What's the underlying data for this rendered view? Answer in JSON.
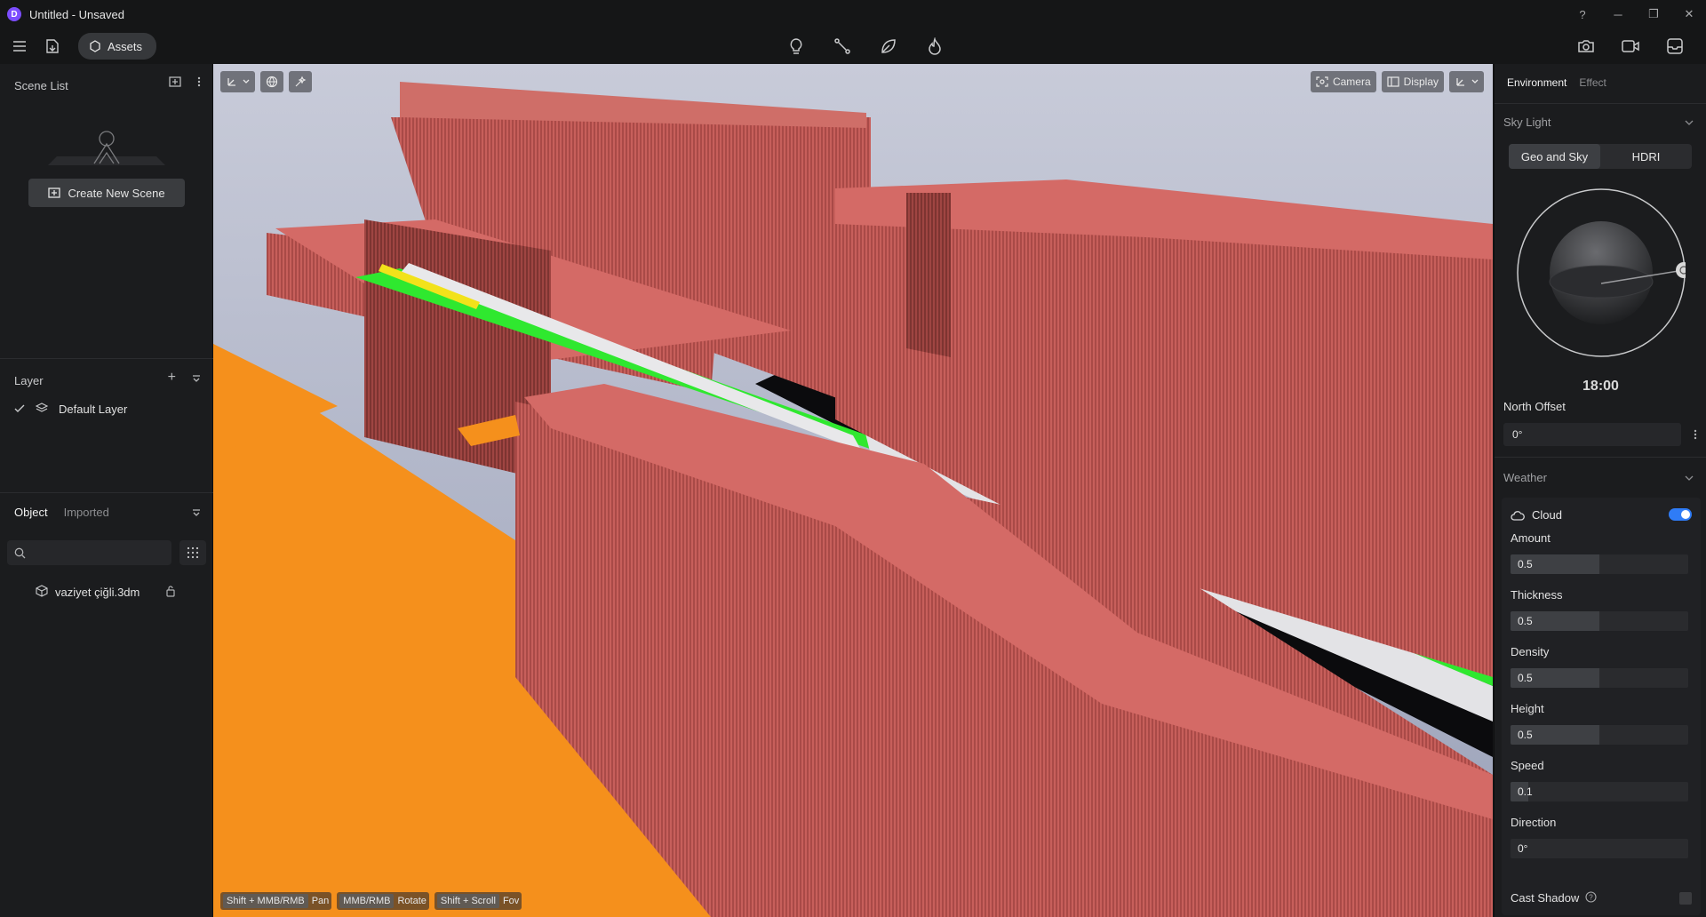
{
  "window": {
    "title": "Untitled - Unsaved",
    "logo_letter": "D"
  },
  "toolbar": {
    "assets_label": "Assets"
  },
  "scene_list": {
    "title": "Scene List",
    "create_label": "Create New Scene"
  },
  "layer": {
    "title": "Layer",
    "items": [
      {
        "label": "Default Layer"
      }
    ]
  },
  "objects": {
    "tabs": [
      {
        "label": "Object"
      },
      {
        "label": "Imported"
      }
    ],
    "search_placeholder": "",
    "items": [
      {
        "label": "vaziyet çiğli.3dm"
      }
    ]
  },
  "viewport": {
    "camera_label": "Camera",
    "display_label": "Display",
    "hints": [
      {
        "key": "Shift + MMB/RMB",
        "action": "Pan"
      },
      {
        "key": "MMB/RMB",
        "action": "Rotate"
      },
      {
        "key": "Shift + Scroll",
        "action": "Fov"
      }
    ]
  },
  "environment": {
    "tabs": [
      {
        "label": "Environment"
      },
      {
        "label": "Effect"
      }
    ],
    "sky_light": {
      "title": "Sky Light",
      "modes": [
        {
          "label": "Geo and Sky"
        },
        {
          "label": "HDRI"
        }
      ],
      "time": "18:00",
      "north_offset_label": "North Offset",
      "north_offset_value": "0°"
    },
    "weather": {
      "title": "Weather",
      "cloud_label": "Cloud",
      "cloud_enabled": true,
      "params": [
        {
          "label": "Amount",
          "value": "0.5",
          "fraction": 0.5
        },
        {
          "label": "Thickness",
          "value": "0.5",
          "fraction": 0.5
        },
        {
          "label": "Density",
          "value": "0.5",
          "fraction": 0.5
        },
        {
          "label": "Height",
          "value": "0.5",
          "fraction": 0.5
        },
        {
          "label": "Speed",
          "value": "0.1",
          "fraction": 0.1
        },
        {
          "label": "Direction",
          "value": "0°",
          "fraction": 0
        }
      ],
      "cast_shadow_label": "Cast Shadow"
    }
  },
  "colors": {
    "accent": "#2f7cf6",
    "building": "#d46a66",
    "ground": "#f5901c",
    "park": "#2fe82f",
    "water": "#2a2ad8",
    "sky": "#a9b2c8"
  }
}
